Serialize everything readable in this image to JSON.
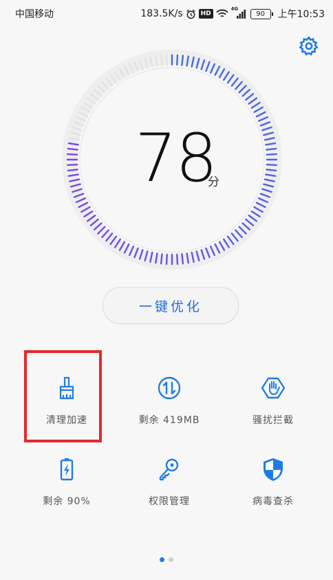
{
  "status_bar": {
    "carrier": "中国移动",
    "network_speed": "183.5K/s",
    "hd_badge": "HD",
    "signal_label": "4G",
    "battery_level": "90",
    "time": "上午10:53"
  },
  "header": {
    "settings_icon": "gear-icon"
  },
  "score": {
    "value": "78",
    "unit": "分"
  },
  "optimize_button": {
    "label": "一键优化"
  },
  "grid": [
    {
      "label": "清理加速",
      "icon": "broom-icon"
    },
    {
      "label": "剩余 419MB",
      "icon": "memory-icon"
    },
    {
      "label": "骚扰拦截",
      "icon": "block-hand-icon"
    },
    {
      "label": "剩余 90%",
      "icon": "battery-icon"
    },
    {
      "label": "权限管理",
      "icon": "key-icon"
    },
    {
      "label": "病毒查杀",
      "icon": "shield-icon"
    }
  ],
  "pager": {
    "pages": 2,
    "active": 0
  },
  "colors": {
    "accent": "#1e7be6",
    "highlight": "#e8262b",
    "ring_tick": "#3f6fdc"
  }
}
